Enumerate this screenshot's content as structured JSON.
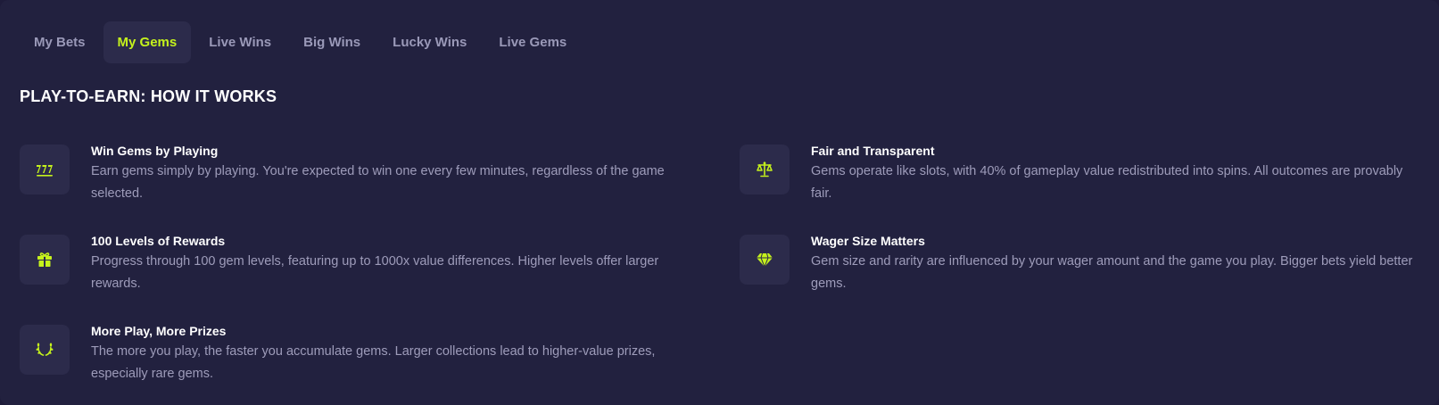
{
  "tabs": [
    {
      "label": "My Bets",
      "active": false
    },
    {
      "label": "My Gems",
      "active": true
    },
    {
      "label": "Live Wins",
      "active": false
    },
    {
      "label": "Big Wins",
      "active": false
    },
    {
      "label": "Lucky Wins",
      "active": false
    },
    {
      "label": "Live Gems",
      "active": false
    }
  ],
  "heading": "PLAY-TO-EARN: HOW IT WORKS",
  "colors": {
    "background": "#22213f",
    "accent": "#c5f21c",
    "icon_tile": "#2c2b4b",
    "muted_text": "#9e9cba"
  },
  "features": [
    {
      "icon": "slot-777-icon",
      "title": "Win Gems by Playing",
      "description": "Earn gems simply by playing. You're expected to win one every few minutes, regardless of the game selected."
    },
    {
      "icon": "scales-icon",
      "title": "Fair and Transparent",
      "description": "Gems operate like slots, with 40% of gameplay value redistributed into spins. All outcomes are provably fair."
    },
    {
      "icon": "gift-icon",
      "title": "100 Levels of Rewards",
      "description": "Progress through 100 gem levels, featuring up to 1000x value differences. Higher levels offer larger rewards."
    },
    {
      "icon": "diamond-icon",
      "title": "Wager Size Matters",
      "description": "Gem size and rarity are influenced by your wager amount and the game you play. Bigger bets yield better gems."
    },
    {
      "icon": "laurel-icon",
      "title": "More Play, More Prizes",
      "description": "The more you play, the faster you accumulate gems. Larger collections lead to higher-value prizes, especially rare gems."
    }
  ]
}
